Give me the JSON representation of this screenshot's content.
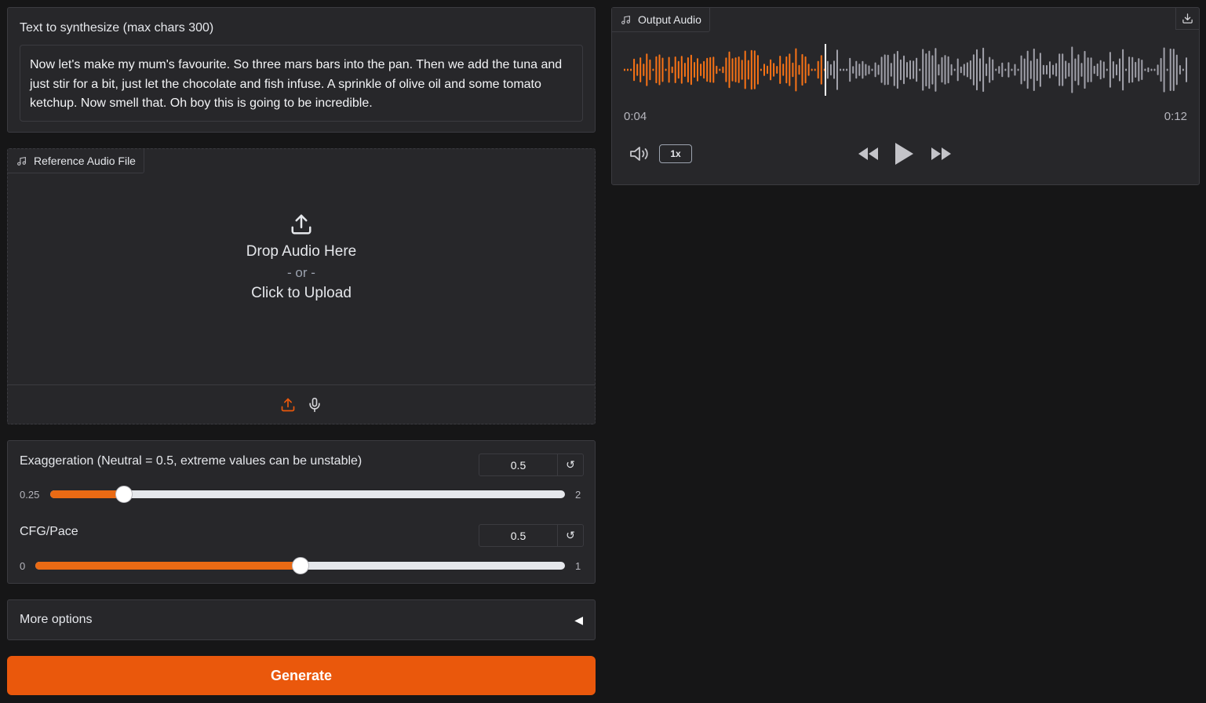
{
  "text_input": {
    "label": "Text to synthesize (max chars 300)",
    "value": "Now let's make my mum's favourite. So three mars bars into the pan. Then we add the tuna and just stir for a bit, just let the chocolate and fish infuse. A sprinkle of olive oil and some tomato ketchup. Now smell that. Oh boy this is going to be incredible."
  },
  "reference_audio": {
    "label": "Reference Audio File",
    "drop_text": "Drop Audio Here",
    "or_text": "- or -",
    "click_text": "Click to Upload",
    "icons": [
      "music-note-icon",
      "upload-icon",
      "microphone-icon"
    ]
  },
  "exaggeration": {
    "label": "Exaggeration (Neutral = 0.5, extreme values can be unstable)",
    "value": "0.5",
    "min": "0.25",
    "max": "2",
    "fraction": 0.1429,
    "reset_icon": "↺"
  },
  "cfg_pace": {
    "label": "CFG/Pace",
    "value": "0.5",
    "min": "0",
    "max": "1",
    "fraction": 0.5,
    "reset_icon": "↺"
  },
  "more_options": {
    "label": "More options",
    "arrow": "◀"
  },
  "generate": {
    "label": "Generate"
  },
  "output_audio": {
    "label": "Output Audio",
    "current_time": "0:04",
    "duration": "0:12",
    "progress_fraction": 0.357,
    "playback_speed": "1x",
    "played_color": "#f97316",
    "unplayed_color": "#a1a1aa"
  },
  "colors": {
    "accent": "#ea580c",
    "background": "#161617",
    "panel": "#27272a"
  }
}
